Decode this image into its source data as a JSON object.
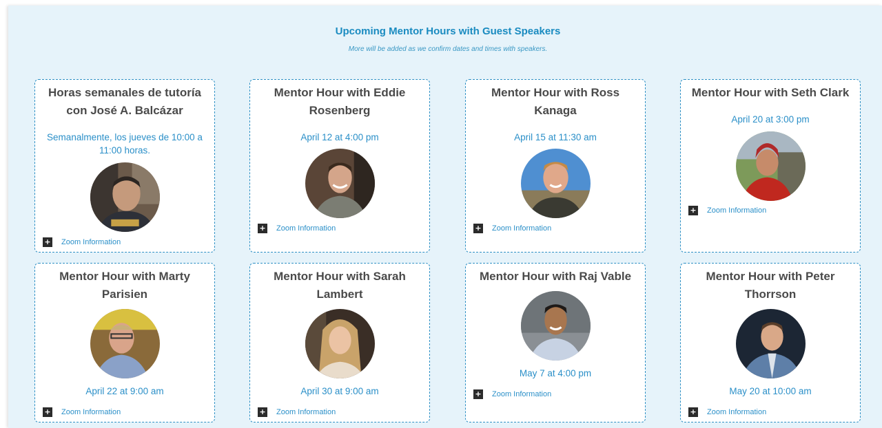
{
  "header": {
    "title": "Upcoming Mentor Hours with Guest Speakers",
    "subtitle": "More will be added as we confirm dates and times with speakers."
  },
  "zoom_label": "Zoom Information",
  "cards": [
    {
      "title": "Horas semanales de tutoría con José A. Balcázar",
      "date": "Semanalmente, los jueves de 10:00 a 11:00 horas."
    },
    {
      "title": "Mentor Hour with Eddie Rosenberg",
      "date": "April 12 at 4:00 pm"
    },
    {
      "title": "Mentor Hour with Ross Kanaga",
      "date": "April 15 at 11:30 am"
    },
    {
      "title": "Mentor Hour with Seth Clark",
      "date": "April 20 at 3:00 pm"
    },
    {
      "title": "Mentor Hour with Marty Parisien",
      "date": "April 22 at 9:00 am"
    },
    {
      "title": "Mentor Hour with Sarah Lambert",
      "date": "April 30 at 9:00 am"
    },
    {
      "title": "Mentor Hour with Raj Vable",
      "date": "May 7 at 4:00 pm"
    },
    {
      "title": "Mentor Hour with Peter Thorrson",
      "date": "May 20 at 10:00 am"
    }
  ]
}
